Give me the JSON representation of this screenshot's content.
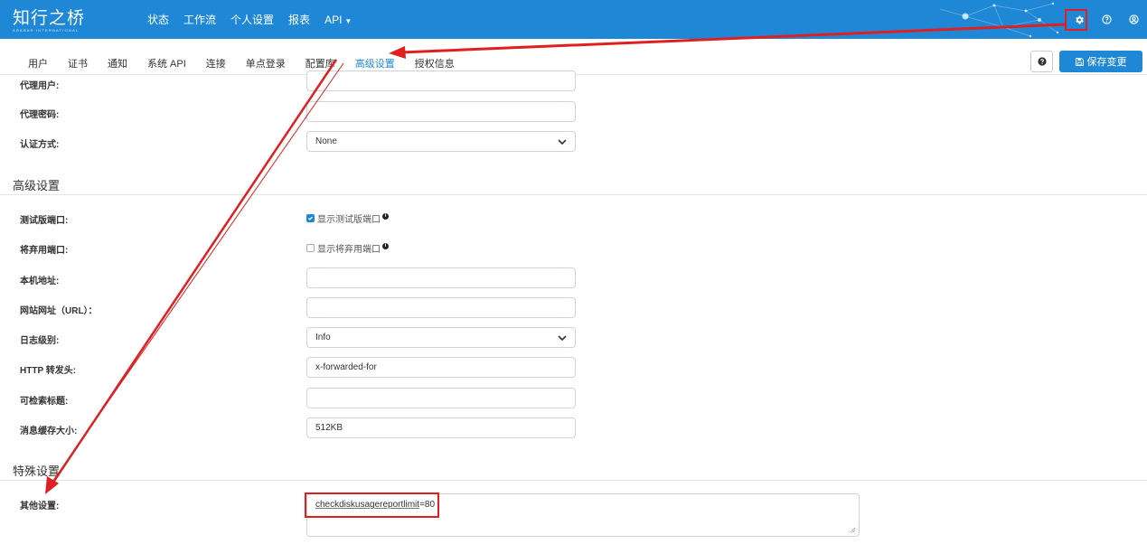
{
  "app": {
    "logo_text": "知行之桥",
    "logo_subtext": "ARABAR INTERNATIONAL"
  },
  "topnav": {
    "items": [
      "状态",
      "工作流",
      "个人设置",
      "报表",
      "API"
    ]
  },
  "tabs": {
    "items": [
      "用户",
      "证书",
      "通知",
      "系统 API",
      "连接",
      "单点登录",
      "配置库",
      "高级设置",
      "授权信息"
    ],
    "active": "高级设置"
  },
  "toolbar": {
    "save_label": "保存变更"
  },
  "proxy": {
    "user_label": "代理用户:",
    "user_value": "",
    "password_label": "代理密码:",
    "password_value": "",
    "auth_label": "认证方式:",
    "auth_value": "None"
  },
  "advanced": {
    "section_title": "高级设置",
    "beta_ports_label": "测试版端口:",
    "beta_ports_option": "显示测试版端口",
    "beta_ports_checked": true,
    "deprecated_ports_label": "将弃用端口:",
    "deprecated_ports_option": "显示将弃用端口",
    "deprecated_ports_checked": false,
    "local_address_label": "本机地址:",
    "local_address_value": "",
    "site_url_label": "网站网址（URL）：",
    "site_url_value": "",
    "log_level_label": "日志级别:",
    "log_level_value": "Info",
    "http_forward_label": "HTTP 转发头:",
    "http_forward_value": "x-forwarded-for",
    "searchable_headers_label": "可检索标题:",
    "searchable_headers_value": "",
    "message_cache_label": "消息缓存大小:",
    "message_cache_value": "512KB"
  },
  "special": {
    "section_title": "特殊设置",
    "other_label": "其他设置:",
    "other_key": "checkdiskusagereportlimit",
    "other_rest": "=80"
  },
  "colors": {
    "brand": "#1e88d6",
    "annotation": "#e02020"
  }
}
